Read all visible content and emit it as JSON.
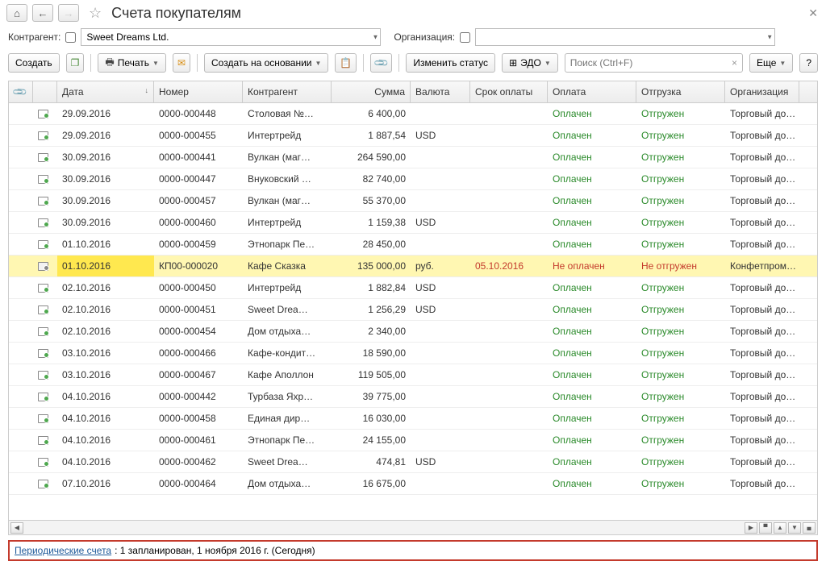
{
  "title": "Счета покупателям",
  "filter": {
    "contractor_label": "Контрагент:",
    "contractor_value": "Sweet Dreams Ltd.",
    "org_label": "Организация:"
  },
  "toolbar": {
    "create": "Создать",
    "print": "Печать",
    "create_on_basis": "Создать на основании",
    "change_status": "Изменить статус",
    "edo": "ЭДО",
    "search_placeholder": "Поиск (Ctrl+F)",
    "more": "Еще"
  },
  "columns": {
    "date": "Дата",
    "number": "Номер",
    "contractor": "Контрагент",
    "sum": "Сумма",
    "currency": "Валюта",
    "due": "Срок оплаты",
    "payment": "Оплата",
    "shipment": "Отгрузка",
    "org": "Организация"
  },
  "rows": [
    {
      "date": "29.09.2016",
      "number": "0000-000448",
      "contractor": "Столовая №…",
      "sum": "6 400,00",
      "currency": "",
      "due": "",
      "payment": "Оплачен",
      "shipment": "Отгружен",
      "org": "Торговый до…",
      "sel": false,
      "paid": true,
      "ship": true
    },
    {
      "date": "29.09.2016",
      "number": "0000-000455",
      "contractor": "Интертрейд",
      "sum": "1 887,54",
      "currency": "USD",
      "due": "",
      "payment": "Оплачен",
      "shipment": "Отгружен",
      "org": "Торговый до…",
      "sel": false,
      "paid": true,
      "ship": true
    },
    {
      "date": "30.09.2016",
      "number": "0000-000441",
      "contractor": "Вулкан (маг…",
      "sum": "264 590,00",
      "currency": "",
      "due": "",
      "payment": "Оплачен",
      "shipment": "Отгружен",
      "org": "Торговый до…",
      "sel": false,
      "paid": true,
      "ship": true
    },
    {
      "date": "30.09.2016",
      "number": "0000-000447",
      "contractor": "Внуковский …",
      "sum": "82 740,00",
      "currency": "",
      "due": "",
      "payment": "Оплачен",
      "shipment": "Отгружен",
      "org": "Торговый до…",
      "sel": false,
      "paid": true,
      "ship": true
    },
    {
      "date": "30.09.2016",
      "number": "0000-000457",
      "contractor": "Вулкан (маг…",
      "sum": "55 370,00",
      "currency": "",
      "due": "",
      "payment": "Оплачен",
      "shipment": "Отгружен",
      "org": "Торговый до…",
      "sel": false,
      "paid": true,
      "ship": true
    },
    {
      "date": "30.09.2016",
      "number": "0000-000460",
      "contractor": "Интертрейд",
      "sum": "1 159,38",
      "currency": "USD",
      "due": "",
      "payment": "Оплачен",
      "shipment": "Отгружен",
      "org": "Торговый до…",
      "sel": false,
      "paid": true,
      "ship": true
    },
    {
      "date": "01.10.2016",
      "number": "0000-000459",
      "contractor": "Этнопарк Пе…",
      "sum": "28 450,00",
      "currency": "",
      "due": "",
      "payment": "Оплачен",
      "shipment": "Отгружен",
      "org": "Торговый до…",
      "sel": false,
      "paid": true,
      "ship": true
    },
    {
      "date": "01.10.2016",
      "number": "КП00-000020",
      "contractor": "Кафе Сказка",
      "sum": "135 000,00",
      "currency": "руб.",
      "due": "05.10.2016",
      "payment": "Не оплачен",
      "shipment": "Не отгружен",
      "org": "Конфетпром…",
      "sel": true,
      "paid": false,
      "ship": false
    },
    {
      "date": "02.10.2016",
      "number": "0000-000450",
      "contractor": "Интертрейд",
      "sum": "1 882,84",
      "currency": "USD",
      "due": "",
      "payment": "Оплачен",
      "shipment": "Отгружен",
      "org": "Торговый до…",
      "sel": false,
      "paid": true,
      "ship": true
    },
    {
      "date": "02.10.2016",
      "number": "0000-000451",
      "contractor": "Sweet Drea…",
      "sum": "1 256,29",
      "currency": "USD",
      "due": "",
      "payment": "Оплачен",
      "shipment": "Отгружен",
      "org": "Торговый до…",
      "sel": false,
      "paid": true,
      "ship": true
    },
    {
      "date": "02.10.2016",
      "number": "0000-000454",
      "contractor": "Дом отдыха…",
      "sum": "2 340,00",
      "currency": "",
      "due": "",
      "payment": "Оплачен",
      "shipment": "Отгружен",
      "org": "Торговый до…",
      "sel": false,
      "paid": true,
      "ship": true
    },
    {
      "date": "03.10.2016",
      "number": "0000-000466",
      "contractor": "Кафе-кондит…",
      "sum": "18 590,00",
      "currency": "",
      "due": "",
      "payment": "Оплачен",
      "shipment": "Отгружен",
      "org": "Торговый до…",
      "sel": false,
      "paid": true,
      "ship": true
    },
    {
      "date": "03.10.2016",
      "number": "0000-000467",
      "contractor": "Кафе Аполлон",
      "sum": "119 505,00",
      "currency": "",
      "due": "",
      "payment": "Оплачен",
      "shipment": "Отгружен",
      "org": "Торговый до…",
      "sel": false,
      "paid": true,
      "ship": true
    },
    {
      "date": "04.10.2016",
      "number": "0000-000442",
      "contractor": "Турбаза Яхр…",
      "sum": "39 775,00",
      "currency": "",
      "due": "",
      "payment": "Оплачен",
      "shipment": "Отгружен",
      "org": "Торговый до…",
      "sel": false,
      "paid": true,
      "ship": true
    },
    {
      "date": "04.10.2016",
      "number": "0000-000458",
      "contractor": "Единая дир…",
      "sum": "16 030,00",
      "currency": "",
      "due": "",
      "payment": "Оплачен",
      "shipment": "Отгружен",
      "org": "Торговый до…",
      "sel": false,
      "paid": true,
      "ship": true
    },
    {
      "date": "04.10.2016",
      "number": "0000-000461",
      "contractor": "Этнопарк Пе…",
      "sum": "24 155,00",
      "currency": "",
      "due": "",
      "payment": "Оплачен",
      "shipment": "Отгружен",
      "org": "Торговый до…",
      "sel": false,
      "paid": true,
      "ship": true
    },
    {
      "date": "04.10.2016",
      "number": "0000-000462",
      "contractor": "Sweet Drea…",
      "sum": "474,81",
      "currency": "USD",
      "due": "",
      "payment": "Оплачен",
      "shipment": "Отгружен",
      "org": "Торговый до…",
      "sel": false,
      "paid": true,
      "ship": true
    },
    {
      "date": "07.10.2016",
      "number": "0000-000464",
      "contractor": "Дом отдыха…",
      "sum": "16 675,00",
      "currency": "",
      "due": "",
      "payment": "Оплачен",
      "shipment": "Отгружен",
      "org": "Торговый до…",
      "sel": false,
      "paid": true,
      "ship": true
    }
  ],
  "status": {
    "link": "Периодические счета",
    "text": ": 1 запланирован, 1 ноября 2016 г. (Сегодня)"
  }
}
